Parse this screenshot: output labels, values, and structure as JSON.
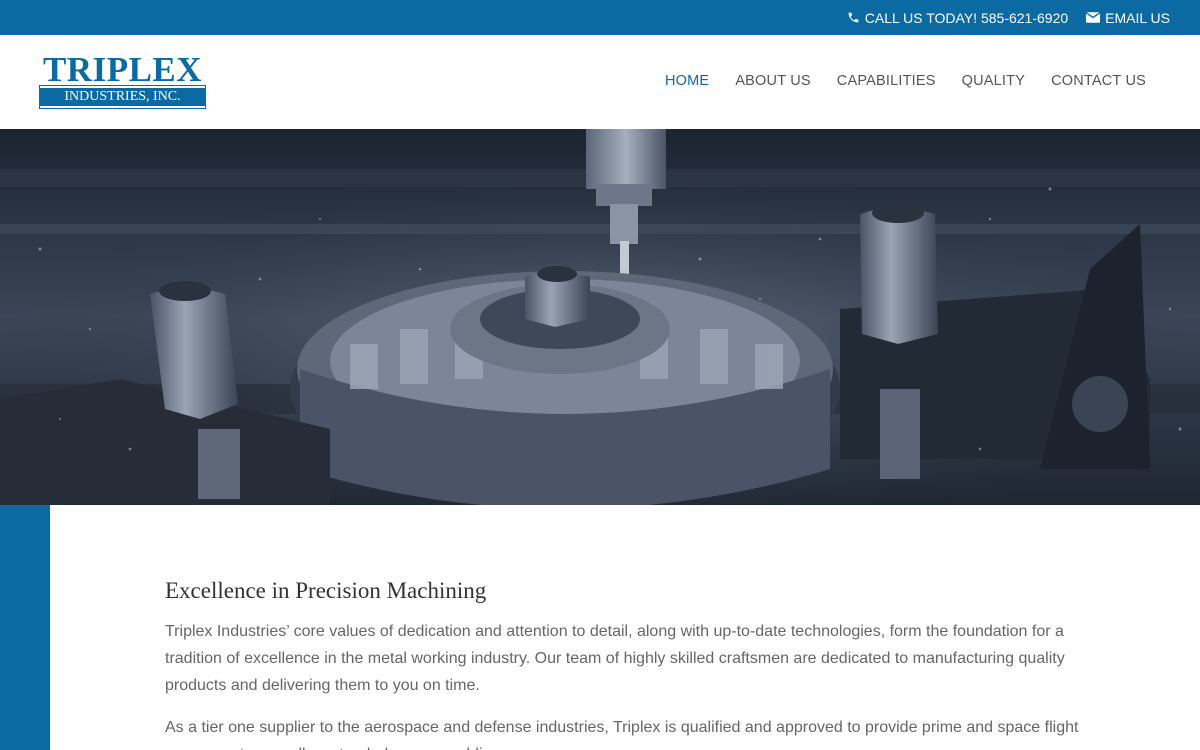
{
  "topbar": {
    "phone_label": "CALL US TODAY! 585-621-6920",
    "email_label": "EMAIL US",
    "phone_icon": "phone-icon",
    "email_icon": "envelope-icon"
  },
  "logo": {
    "name": "TRIPLEX",
    "subtitle": "INDUSTRIES, INC."
  },
  "nav": {
    "items": [
      {
        "label": "HOME",
        "active": true
      },
      {
        "label": "ABOUT US"
      },
      {
        "label": "CAPABILITIES"
      },
      {
        "label": "QUALITY"
      },
      {
        "label": "CONTACT US"
      }
    ]
  },
  "main": {
    "heading": "Excellence in Precision Machining",
    "paragraphs": [
      "Triplex Industries’ core values of dedication and attention to detail, along with up-to-date technologies, form the foundation for a tradition of excellence in the metal working industry. Our team of highly skilled craftsmen are dedicated to manufacturing quality products and delivering them to you on time.",
      "As a tier one supplier to the aerospace and defense industries, Triplex is qualified and approved to provide prime and space flight components as well as stand-alone assemblies."
    ]
  },
  "colors": {
    "brand_blue": "#0b6aa2",
    "nav_text": "#555555",
    "body_text": "#666666"
  }
}
